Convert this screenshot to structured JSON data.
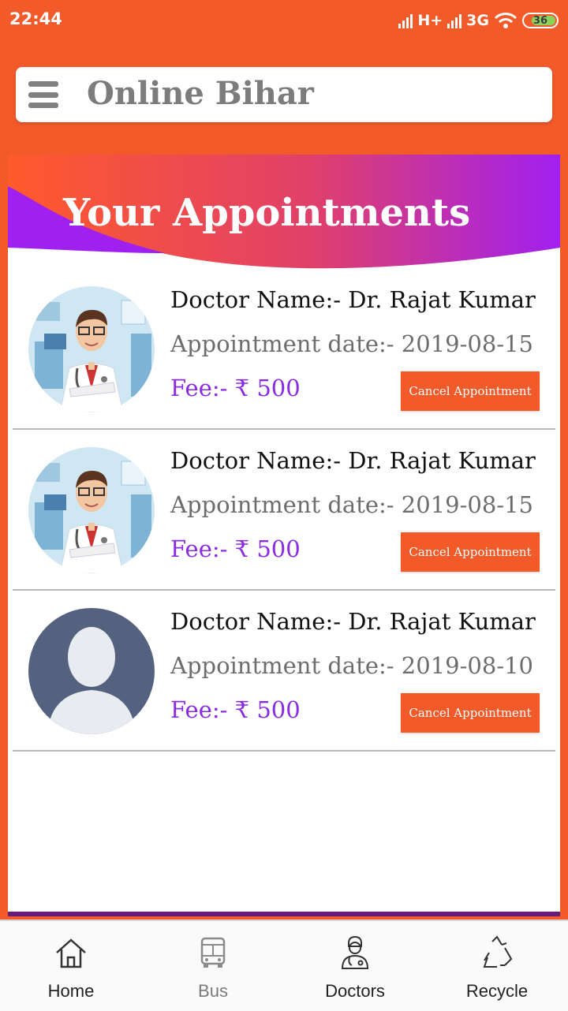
{
  "status": {
    "time": "22:44",
    "network1": "H+",
    "network2": "3G",
    "battery": "36"
  },
  "toolbar": {
    "title": "Online Bihar"
  },
  "page": {
    "heading": "Your Appointments"
  },
  "appointments": [
    {
      "doctor": "Doctor Name:- Dr. Rajat Kumar",
      "date": "Appointment date:- 2019-08-15",
      "fee": "Fee:- ₹ 500",
      "button": "Cancel Appointment",
      "avatar": "doctor-illustration"
    },
    {
      "doctor": "Doctor Name:- Dr. Rajat Kumar",
      "date": "Appointment date:- 2019-08-15",
      "fee": "Fee:- ₹ 500",
      "button": "Cancel Appointment",
      "avatar": "doctor-illustration"
    },
    {
      "doctor": "Doctor Name:- Dr. Rajat Kumar",
      "date": "Appointment date:- 2019-08-10",
      "fee": "Fee:- ₹ 500",
      "button": "Cancel Appointment",
      "avatar": "default-user"
    }
  ],
  "bottom_nav": [
    {
      "label": "Home",
      "icon": "home-icon"
    },
    {
      "label": "Bus",
      "icon": "bus-icon"
    },
    {
      "label": "Doctors",
      "icon": "doctor-icon"
    },
    {
      "label": "Recycle",
      "icon": "recycle-icon"
    }
  ],
  "colors": {
    "accent": "#f25a2a",
    "fee": "#8a2be2",
    "banner_purple": "#a020f0"
  }
}
